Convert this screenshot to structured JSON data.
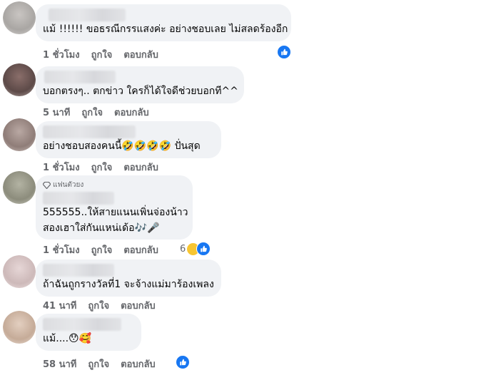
{
  "colors": {
    "accent": "#1877f2",
    "meta": "#65676b",
    "bubble": "#f0f2f5",
    "text": "#050505"
  },
  "comments": [
    {
      "text": "แม้ !!!!!! ขอธรณีกรรแสงค่ะ อย่างชอบเลย ไม่สลดร้องอีก",
      "time": "1 ชั่วโมง",
      "like": "ถูกใจ",
      "reply": "ตอบกลับ",
      "reaction_icon": "like-icon"
    },
    {
      "text": "บอกตรงๆ.. ตกข่าว ใครก็ได้ใจดีช่วยบอกที^^",
      "time": "5 นาที",
      "like": "ถูกใจ",
      "reply": "ตอบกลับ"
    },
    {
      "text": "อย่างชอบสองคนนี้🤣🤣🤣🤣 ปั่นสุด",
      "time": "1 ชั่วโมง",
      "like": "ถูกใจ",
      "reply": "ตอบกลับ"
    },
    {
      "badge": "แฟนตัวยง",
      "lines": [
        "555555..ให้สายแนนเพิ่นจ่องน้าว",
        "สองเฮาใส่กันแหน่เด้อ🎶🎤"
      ],
      "time": "1 ชั่วโมง",
      "like": "ถูกใจ",
      "reply": "ตอบกลับ",
      "reaction_count": "6"
    },
    {
      "text": "ถ้าฉันถูกรางวัลที่1 จะจ้างแม่มาร้องเพลง",
      "time": "41 นาที",
      "like": "ถูกใจ",
      "reply": "ตอบกลับ"
    },
    {
      "text": "แม้....😯🥰",
      "time": "58 นาที",
      "like": "ถูกใจ",
      "reply": "ตอบกลับ",
      "reaction_icon": "like-icon"
    }
  ]
}
